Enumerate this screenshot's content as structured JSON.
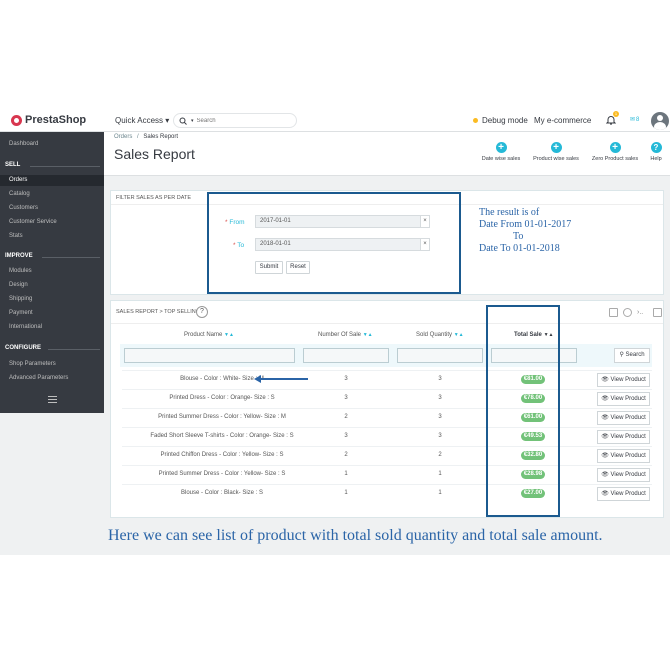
{
  "header": {
    "logo_text": "PrestaShop",
    "quick_access": "Quick Access ▾",
    "search_placeholder": "Search",
    "debug_mode": "Debug mode",
    "shop_name": "My e-commerce",
    "notifications_count": "1",
    "messages_count": "8"
  },
  "sidebar": {
    "dashboard": "Dashboard",
    "sell": "SELL",
    "sell_items": [
      "Orders",
      "Catalog",
      "Customers",
      "Customer Service",
      "Stats"
    ],
    "improve": "IMPROVE",
    "improve_items": [
      "Modules",
      "Design",
      "Shipping",
      "Payment",
      "International"
    ],
    "configure": "CONFIGURE",
    "configure_items": [
      "Shop Parameters",
      "Advanced Parameters"
    ]
  },
  "page": {
    "breadcrumb_parent": "Orders",
    "breadcrumb_sep": "/",
    "breadcrumb_current": "Sales Report",
    "title": "Sales Report",
    "toolbar": [
      "Date wise sales",
      "Product wise sales",
      "Zero Product sales",
      "Help"
    ]
  },
  "filter": {
    "heading": "FILTER SALES AS PER DATE",
    "from_label": "From",
    "from_value": "2017-01-01",
    "to_label": "To",
    "to_value": "2018-01-01",
    "clear": "×",
    "submit": "Submit",
    "reset": "Reset",
    "note_line1": "The result is of",
    "note_line2": "Date From 01-01-2017",
    "note_line3": "To",
    "note_line4": "Date To 01-01-2018"
  },
  "report": {
    "heading": "SALES REPORT > TOP SELLING",
    "help": "?",
    "columns": [
      "Product Name",
      "Number Of Sale",
      "Sold Quantity",
      "Total Sale"
    ],
    "search": "Search",
    "view_label": "View Product",
    "rows": [
      {
        "name": "Blouse - Color : White- Size : M",
        "sales": "3",
        "qty": "3",
        "total": "€81.00"
      },
      {
        "name": "Printed Dress - Color : Orange- Size : S",
        "sales": "3",
        "qty": "3",
        "total": "€78.00"
      },
      {
        "name": "Printed Summer Dress - Color : Yellow- Size : M",
        "sales": "2",
        "qty": "3",
        "total": "€61.00"
      },
      {
        "name": "Faded Short Sleeve T-shirts - Color : Orange- Size : S",
        "sales": "3",
        "qty": "3",
        "total": "€49.53"
      },
      {
        "name": "Printed Chiffon Dress - Color : Yellow- Size : S",
        "sales": "2",
        "qty": "2",
        "total": "€32.80"
      },
      {
        "name": "Printed Summer Dress - Color : Yellow- Size : S",
        "sales": "1",
        "qty": "1",
        "total": "€28.98"
      },
      {
        "name": "Blouse - Color : Black- Size : S",
        "sales": "1",
        "qty": "1",
        "total": "€27.00"
      }
    ]
  },
  "caption": "Here we can see list of product with total sold quantity and total sale amount."
}
